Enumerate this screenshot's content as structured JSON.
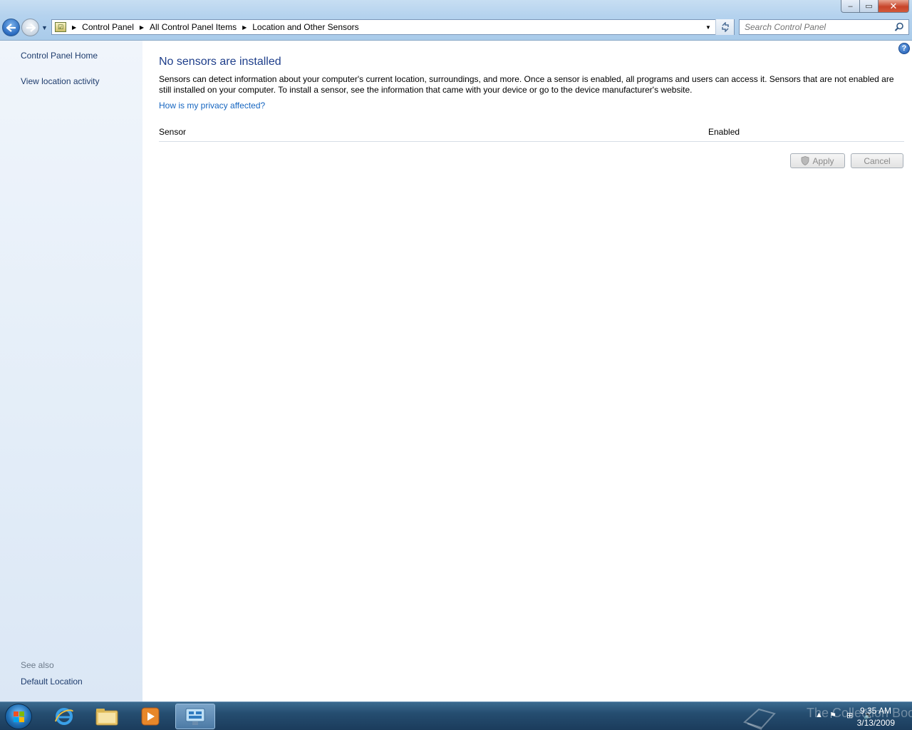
{
  "window": {
    "controls": {
      "minimize": "–",
      "maximize": "▭",
      "close": "✕"
    }
  },
  "nav": {
    "back_icon": "arrow-left-icon",
    "forward_icon": "arrow-right-icon"
  },
  "address_bar": {
    "crumbs": [
      "Control Panel",
      "All Control Panel Items",
      "Location and Other Sensors"
    ]
  },
  "search": {
    "placeholder": "Search Control Panel"
  },
  "left_pane": {
    "links": [
      "Control Panel Home",
      "View location activity"
    ],
    "see_also_heading": "See also",
    "see_also_links": [
      "Default Location"
    ]
  },
  "main": {
    "title": "No sensors are installed",
    "description": "Sensors can detect information about your computer's current location, surroundings, and more. Once a sensor is enabled, all programs and users can access it. Sensors that are not enabled are still installed on your computer. To install a sensor, see the information that came with your device or go to the device manufacturer's website.",
    "privacy_link": "How is my privacy affected?",
    "table": {
      "columns": [
        "Sensor",
        "Enabled"
      ],
      "rows": []
    },
    "buttons": {
      "apply": "Apply",
      "cancel": "Cancel"
    }
  },
  "taskbar": {
    "watermark": "The Collection Book",
    "clock": {
      "time": "9:35 AM",
      "date": "3/13/2009"
    }
  },
  "colors": {
    "title_blue": "#1e3e8a",
    "link_blue": "#1565c0",
    "nav_link": "#1e3c6d"
  }
}
